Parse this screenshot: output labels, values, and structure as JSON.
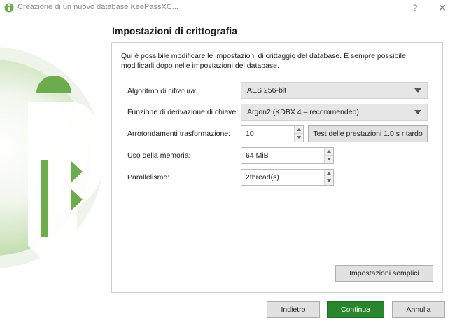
{
  "window": {
    "title": "Creazione di un nuovo database KeePassXC...",
    "help_label": "?",
    "close_label": "✕"
  },
  "page": {
    "title": "Impostazioni di crittografia",
    "description": "Qui è possibile modificare le impostazioni di crittaggio del database. È sempre possibile modificarli dopo nelle impostazioni del database."
  },
  "form": {
    "cipher": {
      "label": "Algoritmo di cifratura:",
      "value": "AES 256-bit"
    },
    "kdf": {
      "label": "Funzione di derivazione di chiave:",
      "value": "Argon2 (KDBX 4 – recommended)"
    },
    "rounds": {
      "label": "Arrotondamenti trasformazione:",
      "value": "10",
      "benchmark_label": "Test delle prestazioni 1.0 s ritardo"
    },
    "memory": {
      "label": "Uso della memoria:",
      "value": "64 MiB"
    },
    "parallelism": {
      "label": "Parallelismo:",
      "value": "2thread(s)"
    }
  },
  "simple_settings_label": "Impostazioni semplici",
  "footer": {
    "back_label": "Indietro",
    "continue_label": "Continua",
    "cancel_label": "Annulla"
  },
  "colors": {
    "brand_green": "#6cac4d",
    "primary_button": "#29862d"
  }
}
